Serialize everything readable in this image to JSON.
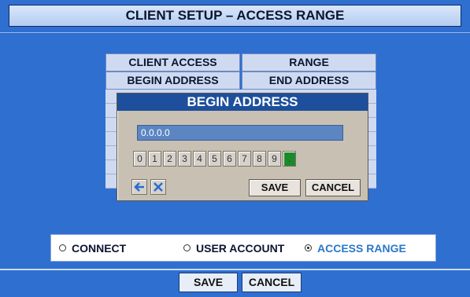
{
  "window": {
    "title": "CLIENT SETUP – ACCESS RANGE"
  },
  "table": {
    "headers": [
      "CLIENT ACCESS",
      "RANGE"
    ],
    "subheaders": [
      "BEGIN ADDRESS",
      "END ADDRESS"
    ]
  },
  "dialog": {
    "title": "BEGIN ADDRESS",
    "address_value": "0.0.0.0",
    "keys": [
      "0",
      "1",
      "2",
      "3",
      "4",
      "5",
      "6",
      "7",
      "8",
      "9",
      "."
    ],
    "back_icon": "back-arrow-icon",
    "clear_icon": "clear-x-icon",
    "save_label": "SAVE",
    "cancel_label": "CANCEL"
  },
  "radios": [
    {
      "label": "CONNECT",
      "selected": false
    },
    {
      "label": "USER ACCOUNT",
      "selected": false
    },
    {
      "label": "ACCESS RANGE",
      "selected": true
    }
  ],
  "footer": {
    "save_label": "SAVE",
    "cancel_label": "CANCEL"
  },
  "colors": {
    "background": "#2f6fd0",
    "dialog_title": "#1d4f9c",
    "active_radio": "#2a78c8"
  }
}
